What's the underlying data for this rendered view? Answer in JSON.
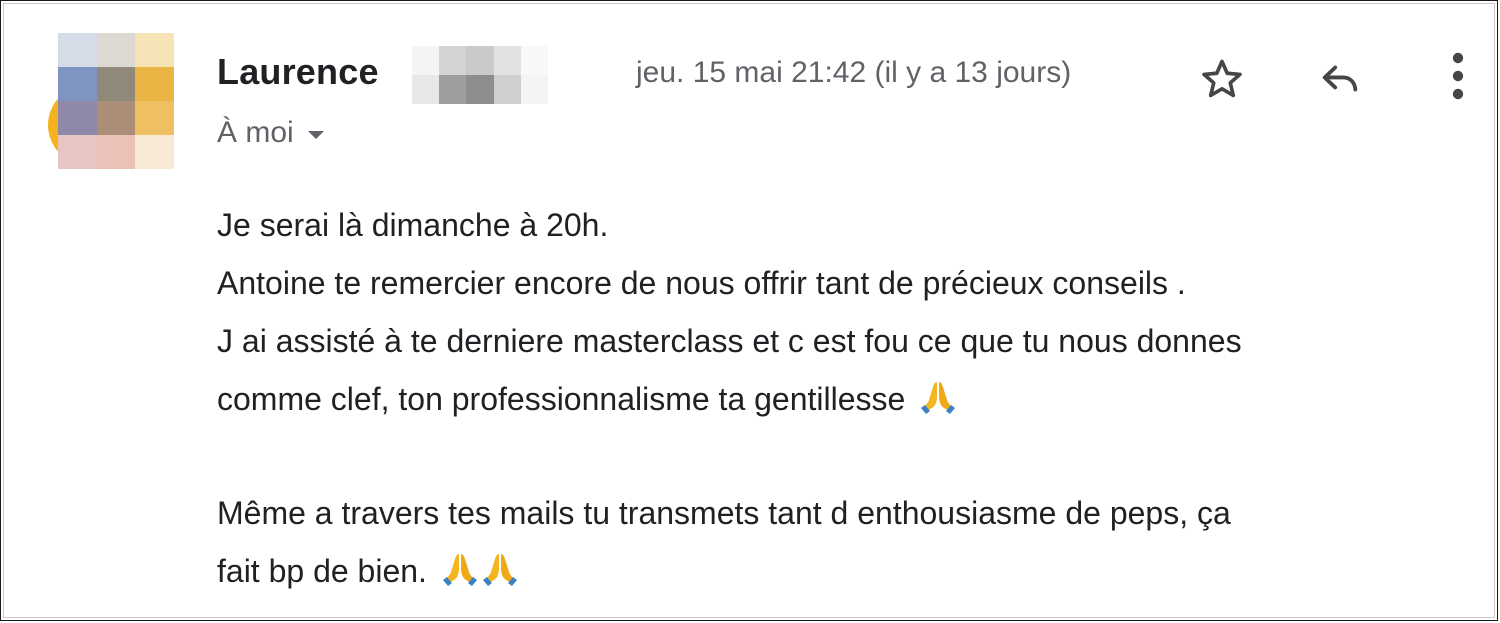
{
  "message": {
    "sender_name": "Laurence",
    "recipient_label": "À moi",
    "date": "jeu. 15 mai 21:42 (il y a 13 jours)",
    "icons": {
      "star": "star-icon",
      "reply": "reply-icon",
      "more": "more-vert-icon",
      "caret": "caret-down-icon"
    },
    "body": {
      "line1": "Je serai là dimanche à 20h.",
      "line2": "Antoine te remercier encore de nous offrir tant de précieux conseils .",
      "line3": "J ai assisté à te derniere masterclass et c est fou ce que tu nous donnes",
      "line4": "comme clef, ton professionnalisme ta gentillesse",
      "line5": "Même a travers tes mails tu transmets tant d enthousiasme de peps, ça",
      "line6": "fait bp de bien."
    },
    "emoji": "folded-hands"
  },
  "colors": {
    "text": "#202124",
    "secondary": "#5f6368",
    "emoji_yellow": "#f5b51f",
    "emoji_blue": "#3b82c4"
  }
}
